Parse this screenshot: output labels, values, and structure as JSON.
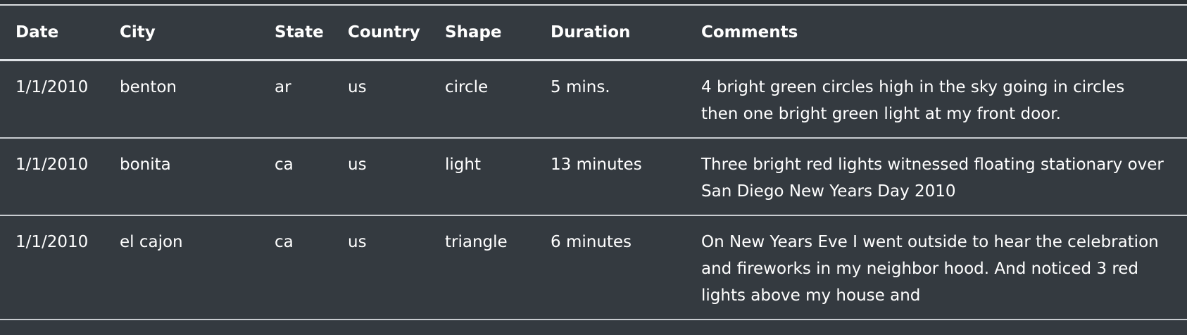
{
  "table": {
    "headers": [
      "Date",
      "City",
      "State",
      "Country",
      "Shape",
      "Duration",
      "Comments"
    ],
    "rows": [
      {
        "date": "1/1/2010",
        "city": "benton",
        "state": "ar",
        "country": "us",
        "shape": "circle",
        "duration": "5 mins.",
        "comments": "4 bright green circles high in the sky going in circles then one bright green light at my front door."
      },
      {
        "date": "1/1/2010",
        "city": "bonita",
        "state": "ca",
        "country": "us",
        "shape": "light",
        "duration": "13 minutes",
        "comments": "Three bright red lights witnessed floating stationary over San Diego New Years Day 2010"
      },
      {
        "date": "1/1/2010",
        "city": "el cajon",
        "state": "ca",
        "country": "us",
        "shape": "triangle",
        "duration": "6 minutes",
        "comments": "On New Years Eve I went outside to hear the celebration and fireworks in my neighbor hood. And noticed 3 red lights above my house and"
      }
    ]
  }
}
